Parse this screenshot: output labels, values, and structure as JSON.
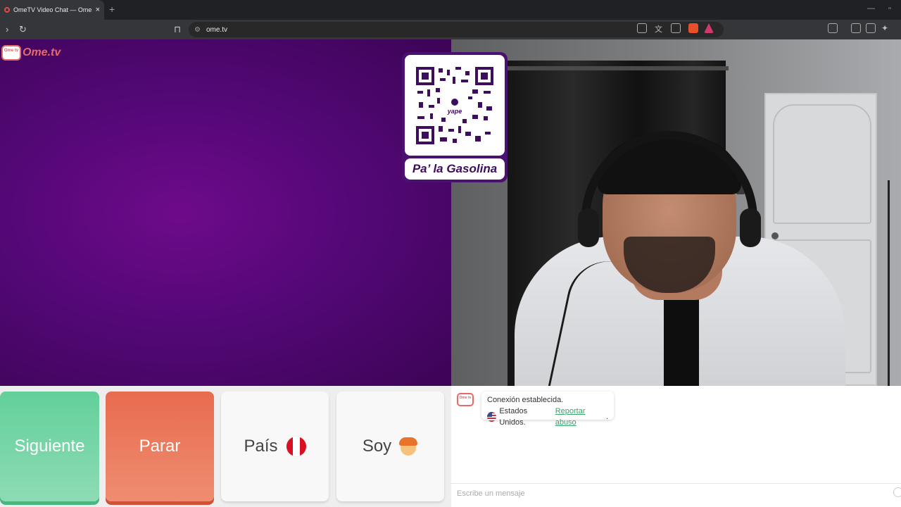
{
  "browser": {
    "tab_title": "OmeTV Video Chat — Omegle",
    "tab_close": "×",
    "new_tab": "+",
    "url": "ome.tv"
  },
  "icons": {
    "back": "chevron-right-icon",
    "reload": "reload-icon",
    "bookmark": "bookmark-icon",
    "site_info": "tune-icon"
  },
  "site": {
    "logo_tv": "Ome tv",
    "logo_text": "Ome.tv"
  },
  "overlay": {
    "qr_brand": "yape",
    "caption": "Pa’ la Gasolina"
  },
  "controls": {
    "next_label": "Siguiente",
    "stop_label": "Parar",
    "country_label": "País",
    "gender_label": "Soy"
  },
  "chat": {
    "logo": "Ome tv",
    "status": "Conexión establecida.",
    "country": "Estados Unidos.",
    "report_link": "Reportar abuso",
    "report_suffix": ".",
    "input_placeholder": "Escribe un mensaje"
  },
  "colors": {
    "next_green": "#62d09b",
    "stop_red": "#e86b4f",
    "left_video_purple": "#540877",
    "qr_frame": "#4b1170",
    "link_green": "#3aa36b"
  }
}
